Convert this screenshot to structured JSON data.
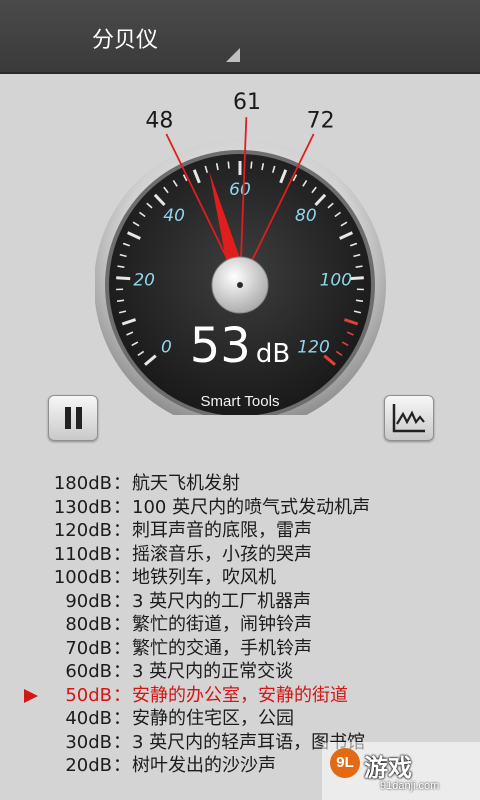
{
  "app": {
    "title": "分贝仪"
  },
  "meter": {
    "current_value": "53",
    "unit": "dB",
    "brand": "Smart Tools",
    "scale_labels": [
      "0",
      "20",
      "40",
      "60",
      "80",
      "100",
      "120"
    ],
    "scale_max": 120,
    "markers": [
      {
        "label": "48",
        "value": 48
      },
      {
        "label": "61",
        "value": 61
      },
      {
        "label": "72",
        "value": 72
      }
    ],
    "needle_value": 53,
    "colors": {
      "accent": "#e01e1e",
      "scale": "#8fd6ec",
      "face": "#2b2b2b"
    }
  },
  "controls": {
    "pause_icon": "pause-icon",
    "chart_icon": "line-chart-icon"
  },
  "reference": {
    "active_index": 9,
    "rows": [
      {
        "db": "180dB",
        "desc": "航天飞机发射"
      },
      {
        "db": "130dB",
        "desc": "100 英尺内的喷气式发动机声"
      },
      {
        "db": "120dB",
        "desc": "刺耳声音的底限，雷声"
      },
      {
        "db": "110dB",
        "desc": "摇滚音乐，小孩的哭声"
      },
      {
        "db": "100dB",
        "desc": "地铁列车，吹风机"
      },
      {
        "db": "90dB",
        "desc": "3 英尺内的工厂机器声"
      },
      {
        "db": "80dB",
        "desc": "繁忙的街道，闹钟铃声"
      },
      {
        "db": "70dB",
        "desc": "繁忙的交通，手机铃声"
      },
      {
        "db": "60dB",
        "desc": "3 英尺内的正常交谈"
      },
      {
        "db": "50dB",
        "desc": "安静的办公室，安静的街道"
      },
      {
        "db": "40dB",
        "desc": "安静的住宅区，公园"
      },
      {
        "db": "30dB",
        "desc": "3 英尺内的轻声耳语，图书馆"
      },
      {
        "db": "20dB",
        "desc": "树叶发出的沙沙声"
      }
    ]
  },
  "watermark": {
    "logo": "9L",
    "name": "游戏",
    "url": "91danji.com"
  }
}
